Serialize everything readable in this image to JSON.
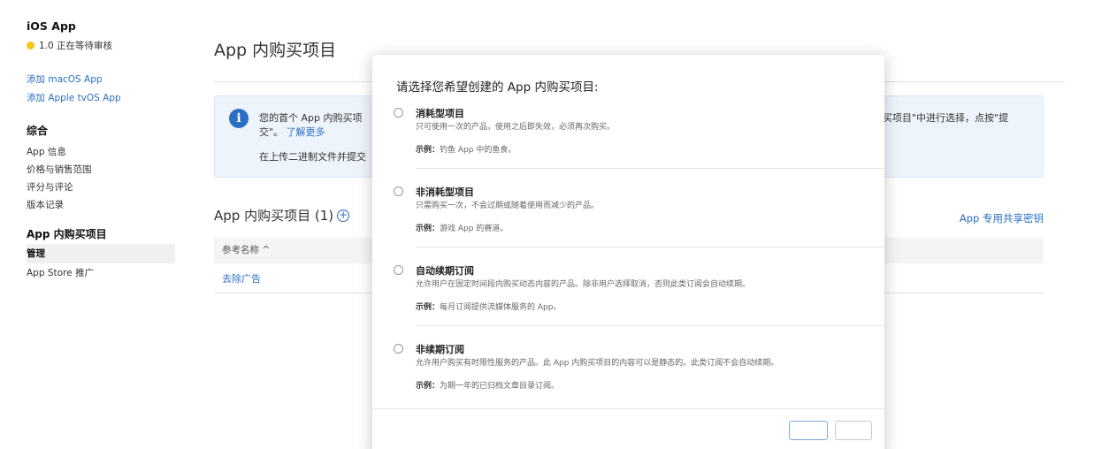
{
  "sidebar": {
    "app_title": "iOS App",
    "status": "1.0 正在等待审核",
    "status_color": "#f5c518",
    "links": [
      "添加 macOS App",
      "添加 Apple tvOS App"
    ],
    "section_general": "综合",
    "general_items": [
      "App 信息",
      "价格与销售范围",
      "评分与评论",
      "版本记录"
    ],
    "section_iap": "App 内购买项目",
    "iap_items": [
      "管理",
      "App Store 推广"
    ]
  },
  "main": {
    "title": "App 内购买项目",
    "info": {
      "line1": "您的首个 App 内购买项",
      "line1_cont": "交\"。",
      "learn_more": "了解更多",
      "line2": "在上传二进制文件并提交",
      "right_text": "买项目\"中进行选择，点按\"提"
    },
    "list_title": "App 内购买项目 (1)",
    "shared_key_link": "App 专用共享密钥",
    "table_header": "参考名称 ^",
    "rows": [
      "去除广告"
    ]
  },
  "modal": {
    "title": "请选择您希望创建的 App 内购买项目:",
    "options": [
      {
        "title": "消耗型项目",
        "desc": "只可使用一次的产品，使用之后即失效，必须再次购买。",
        "example_label": "示例：",
        "example": "钓鱼 App 中的鱼食。"
      },
      {
        "title": "非消耗型项目",
        "desc": "只需购买一次，不会过期或随着使用而减少的产品。",
        "example_label": "示例：",
        "example": "游戏 App 的赛道。"
      },
      {
        "title": "自动续期订阅",
        "desc": "允许用户在固定时间段内购买动态内容的产品。除非用户选择取消，否则此类订阅会自动续期。",
        "example_label": "示例：",
        "example": "每月订阅提供流媒体服务的 App。"
      },
      {
        "title": "非续期订阅",
        "desc": "允许用户购买有时限性服务的产品。此 App 内购买项目的内容可以是静态的。此类订阅不会自动续期。",
        "example_label": "示例：",
        "example": "为期一年的已归档文章目录订阅。"
      }
    ]
  },
  "colors": {
    "link": "#2a6fc4",
    "info_bg": "#eef4fb"
  }
}
